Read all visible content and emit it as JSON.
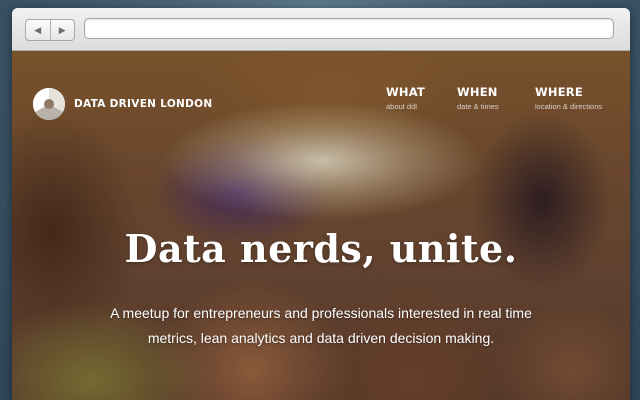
{
  "browser": {
    "back_icon": "chevron-left-icon",
    "forward_icon": "chevron-right-icon",
    "url": ""
  },
  "site": {
    "brand": {
      "logo_icon": "pie-logo-icon",
      "name": "DATA DRIVEN LONDON"
    },
    "nav": [
      {
        "title": "WHAT",
        "subtitle": "about ddl"
      },
      {
        "title": "WHEN",
        "subtitle": "date & times"
      },
      {
        "title": "WHERE",
        "subtitle": "location & directions"
      }
    ],
    "hero": {
      "headline": "Data nerds, unite.",
      "tagline": "A meetup for entrepreneurs and professionals interested in real time metrics, lean analytics and data driven decision making."
    }
  }
}
